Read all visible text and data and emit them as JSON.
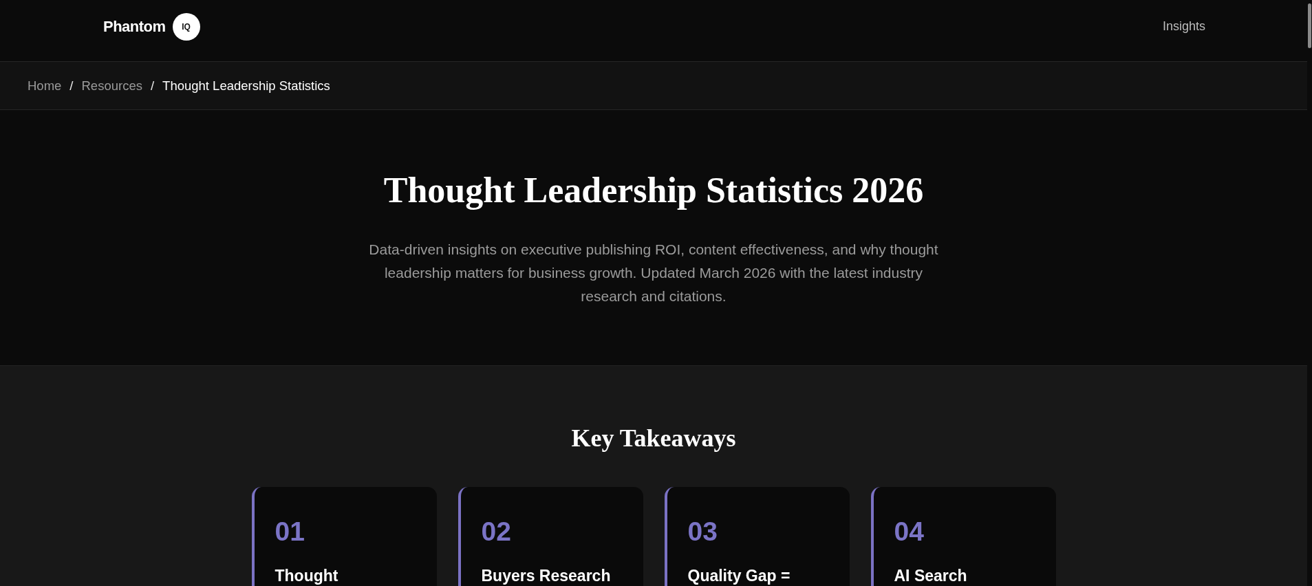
{
  "header": {
    "logo": {
      "wordmark": "Phantom",
      "badge": "IQ"
    },
    "nav": [
      {
        "label": "Insights"
      }
    ]
  },
  "breadcrumb": [
    {
      "kind": "link",
      "label": "Home"
    },
    {
      "kind": "separator",
      "label": "/"
    },
    {
      "kind": "link",
      "label": "Resources"
    },
    {
      "kind": "separator",
      "label": "/"
    },
    {
      "kind": "current",
      "label": "Thought Leadership Statistics"
    }
  ],
  "hero": {
    "title": "Thought Leadership Statistics 2026",
    "subtitle": "Data-driven insights on executive publishing ROI, content effectiveness, and why thought leadership matters for business growth. Updated March 2026 with the latest industry research and citations."
  },
  "takeaways": {
    "heading": "Key Takeaways",
    "cards": [
      {
        "number": "01",
        "title": "Thought"
      },
      {
        "number": "02",
        "title": "Buyers Research"
      },
      {
        "number": "03",
        "title": "Quality Gap ="
      },
      {
        "number": "04",
        "title": "AI Search"
      }
    ]
  }
}
